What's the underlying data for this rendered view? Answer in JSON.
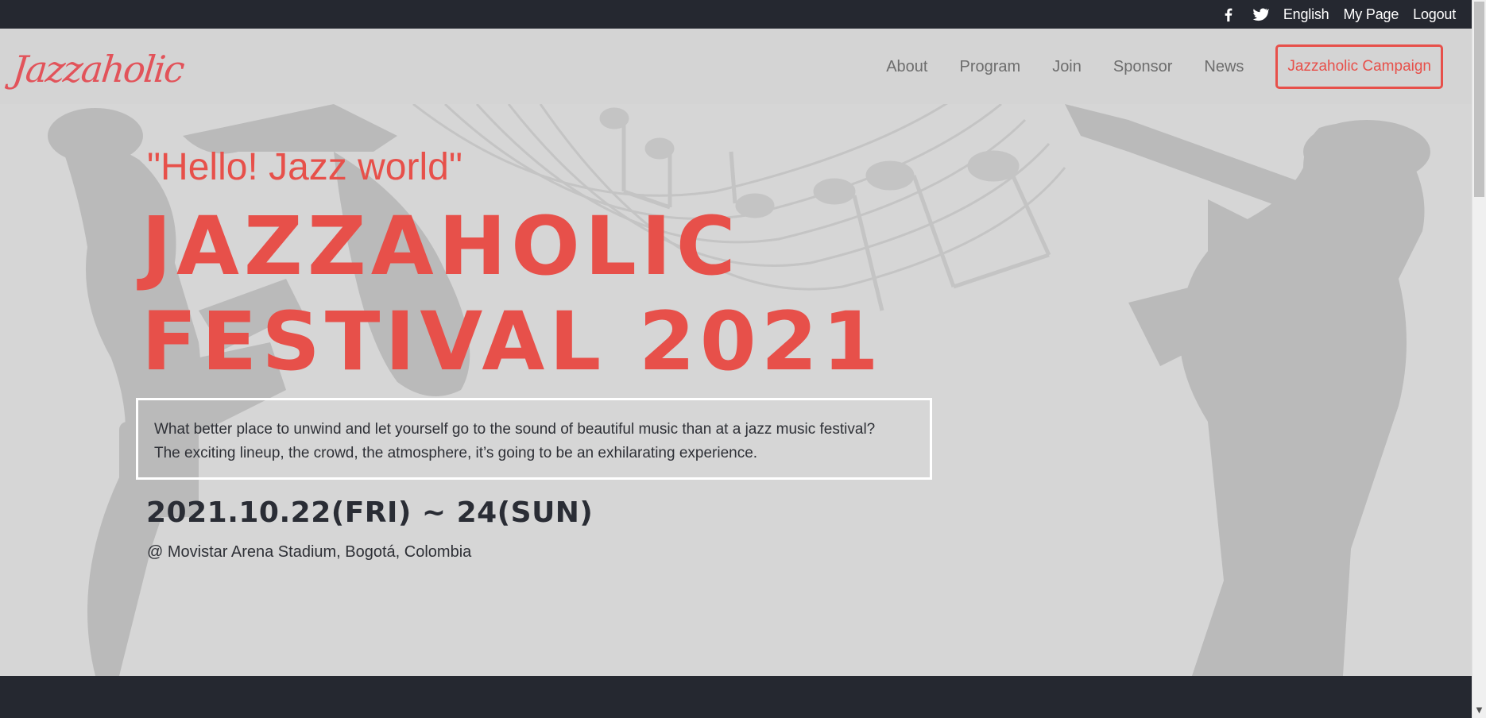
{
  "topbar": {
    "social": [
      {
        "icon": "facebook-icon"
      },
      {
        "icon": "twitter-icon"
      }
    ],
    "language": "English",
    "mypage": "My Page",
    "logout": "Logout"
  },
  "header": {
    "logo_text": "Jazzaholic",
    "nav": [
      "About",
      "Program",
      "Join",
      "Sponsor",
      "News"
    ],
    "campaign_button": "Jazzaholic Campaign"
  },
  "hero": {
    "tagline": "\"Hello! Jazz world\"",
    "title_line1": "JAZZAHOLIC",
    "title_line2": "FESTIVAL 2021",
    "description_line1": "What better place to unwind and let yourself go to the sound of beautiful music than at a jazz music festival?",
    "description_line2": "The exciting lineup, the crowd, the atmosphere, it’s going to be an exhilarating experience.",
    "date": "2021.10.22(FRI) ~ 24(SUN)",
    "venue": "@ Movistar Arena Stadium, Bogotá, Colombia"
  },
  "colors": {
    "accent": "#e7504a",
    "dark": "#252830",
    "background": "#d6d6d6",
    "silhouette": "#b9b9b9"
  }
}
